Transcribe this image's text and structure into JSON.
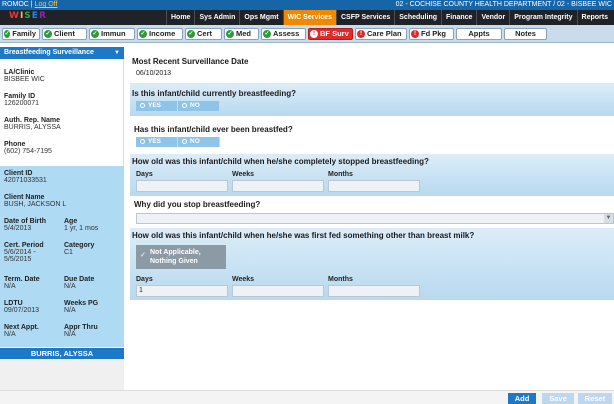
{
  "titlebar": {
    "user": "ROMOC",
    "logoff": "Log Off",
    "department": "02 - COCHISE COUNTY HEALTH DEPARTMENT / 02 - BISBEE WIC"
  },
  "logo": {
    "letters": [
      "W",
      "I",
      "S",
      "E",
      "R"
    ]
  },
  "nav": {
    "items": [
      "Home",
      "Sys Admin",
      "Ops Mgmt",
      "WIC Services",
      "CSFP Services",
      "Scheduling",
      "Finance",
      "Vendor",
      "Program Integrity",
      "Reports"
    ],
    "active": "WIC Services",
    "active_color": "#ef8a00"
  },
  "tabs": [
    {
      "label": "Family",
      "status": "ok"
    },
    {
      "label": "Client",
      "status": "ok"
    },
    {
      "label": "Immun",
      "status": "ok"
    },
    {
      "label": "Income",
      "status": "ok"
    },
    {
      "label": "Cert",
      "status": "ok"
    },
    {
      "label": "Med",
      "status": "ok"
    },
    {
      "label": "Assess",
      "status": "ok"
    },
    {
      "label": "BF Surv",
      "status": "err",
      "active": true
    },
    {
      "label": "Care Plan",
      "status": "err"
    },
    {
      "label": "Fd Pkg",
      "status": "err"
    },
    {
      "label": "Appts",
      "status": "none"
    },
    {
      "label": "Notes",
      "status": "none"
    }
  ],
  "sidebar": {
    "header": "Breastfeeding Surveillance",
    "clinic_label": "LA/Clinic",
    "clinic_value": "BISBEE WIC",
    "family_id_label": "Family ID",
    "family_id_value": "126200071",
    "auth_rep_label": "Auth. Rep. Name",
    "auth_rep_value": "BURRIS, ALYSSA",
    "phone_label": "Phone",
    "phone_value": "(602) 754-7195",
    "client_id_label": "Client ID",
    "client_id_value": "42071033531",
    "client_name_label": "Client Name",
    "client_name_value": "BUSH, JACKSON L",
    "dob_label": "Date of Birth",
    "dob_value": "5/4/2013",
    "age_label": "Age",
    "age_value": "1 yr, 1 mos",
    "cert_period_label": "Cert. Period",
    "cert_period_value_1": "5/6/2014 -",
    "cert_period_value_2": "5/5/2015",
    "category_label": "Category",
    "category_value": "C1",
    "term_date_label": "Term. Date",
    "term_date_value": "N/A",
    "due_date_label": "Due Date",
    "due_date_value": "N/A",
    "ldtu_label": "LDTU",
    "ldtu_value": "09/07/2013",
    "weeks_pg_label": "Weeks PG",
    "weeks_pg_value": "N/A",
    "next_appt_label": "Next Appt.",
    "next_appt_value": "N/A",
    "appr_thru_label": "Appr Thru",
    "appr_thru_value": "N/A",
    "footer": "BURRIS, ALYSSA"
  },
  "main": {
    "recent_label": "Most Recent Surveillance Date",
    "recent_value": "06/10/2013",
    "q1": "Is this infant/child currently breastfeeding?",
    "q2": "Has this infant/child ever been breastfed?",
    "yes": "YES",
    "no": "NO",
    "q3": "How old was this infant/child when he/she completely stopped breastfeeding?",
    "q4": "Why did you stop breastfeeding?",
    "q5": "How old was this infant/child when he/she was first fed something other than breast milk?",
    "days": "Days",
    "weeks": "Weeks",
    "months": "Months",
    "q5_days_value": "1",
    "not_applicable_1": "Not Applicable,",
    "not_applicable_2": "Nothing Given"
  },
  "buttons": {
    "add": "Add",
    "save": "Save",
    "reset": "Reset"
  }
}
